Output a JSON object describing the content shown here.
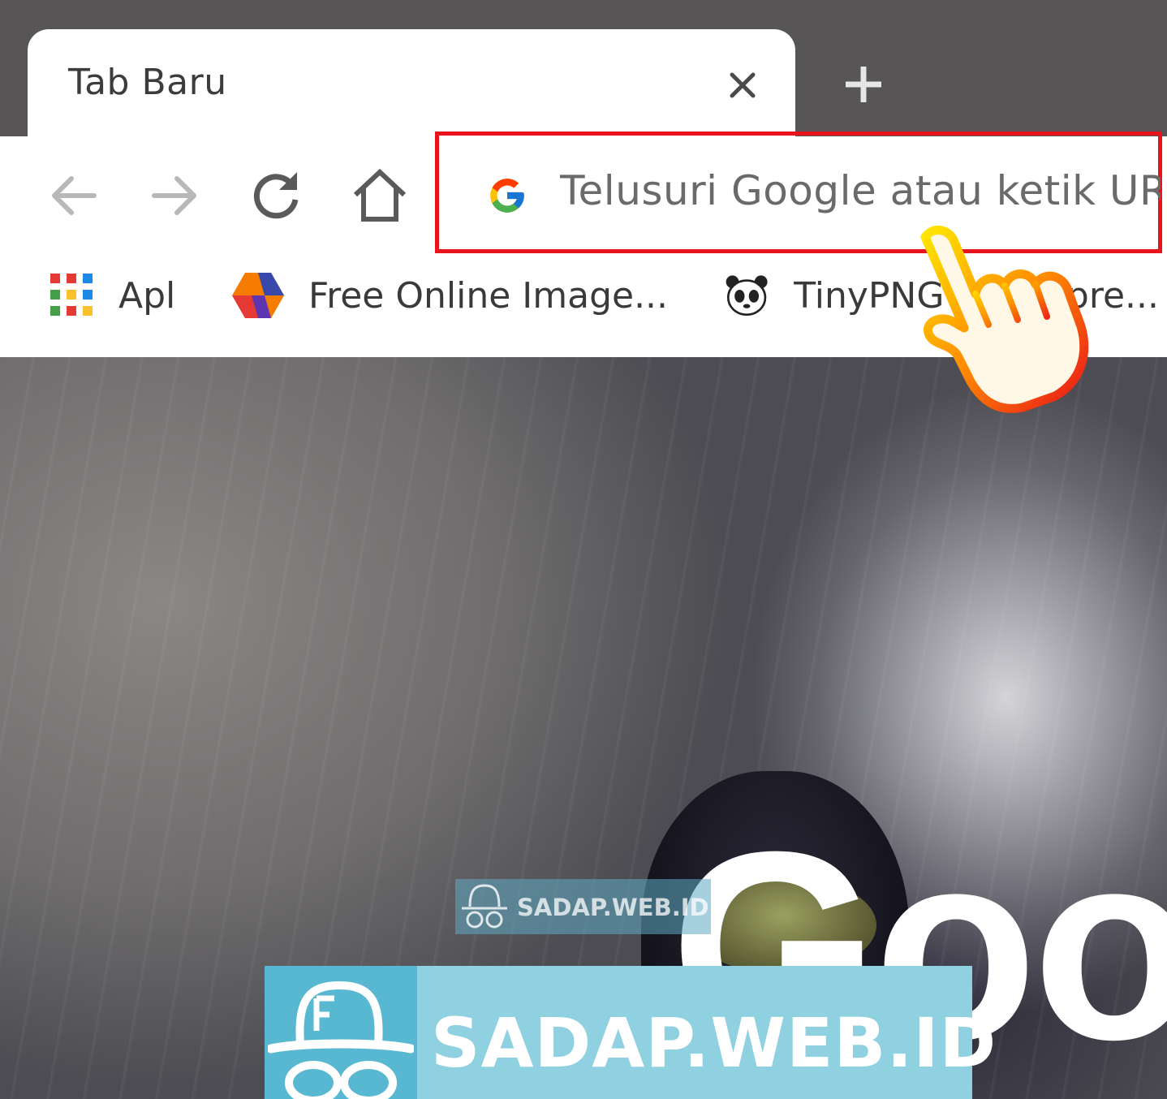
{
  "tab": {
    "title": "Tab Baru"
  },
  "omnibox": {
    "placeholder": "Telusuri Google atau ketik URL"
  },
  "bookmarks": [
    {
      "label": "Apl"
    },
    {
      "label": "Free Online Image..."
    },
    {
      "label": "TinyPNG – Compre..."
    }
  ],
  "watermark": {
    "text": "SADAP.WEB.ID"
  },
  "ntp": {
    "logo_text": "Goo"
  },
  "colors": {
    "highlight": "#e8141b",
    "watermark_bg": "#8fd1e0",
    "watermark_icon_bg": "#58b7d1"
  },
  "icons": [
    "close-icon",
    "plus-icon",
    "back-arrow-icon",
    "forward-arrow-icon",
    "reload-icon",
    "home-icon",
    "google-g-icon",
    "apps-grid-icon",
    "image-app-icon",
    "panda-icon",
    "pointing-hand-icon",
    "hat-glasses-icon"
  ]
}
